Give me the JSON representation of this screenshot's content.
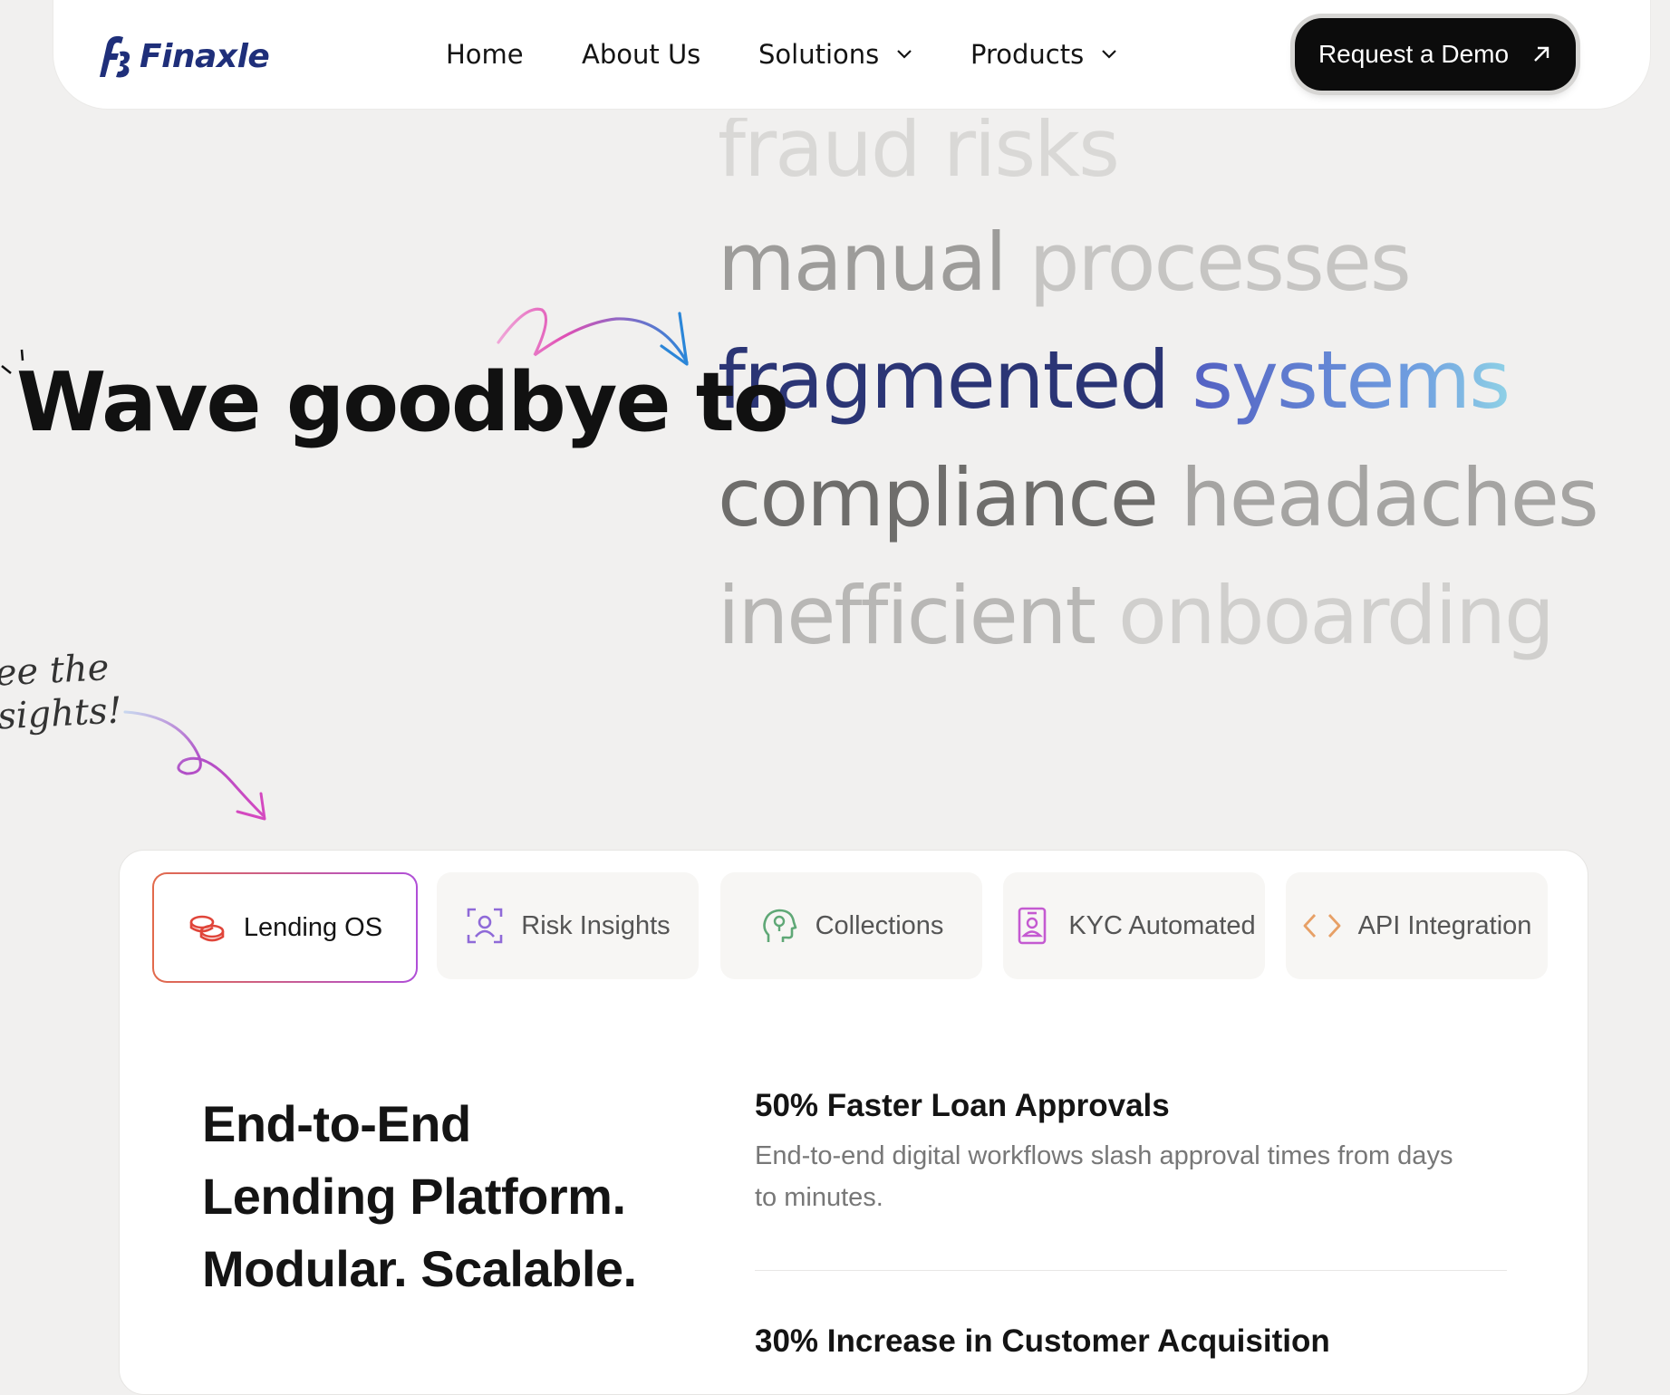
{
  "brand": {
    "name": "Finaxle",
    "primary_color": "#1f2f7a"
  },
  "nav": {
    "items": [
      {
        "label": "Home"
      },
      {
        "label": "About Us"
      },
      {
        "label": "Solutions"
      },
      {
        "label": "Products"
      }
    ],
    "cta_label": "Request a Demo"
  },
  "hero": {
    "heading": "Wave goodbye to",
    "rotating_phrases": [
      {
        "w1": "fraud",
        "w2": "risks"
      },
      {
        "w1": "manual",
        "w2": "processes"
      },
      {
        "w1": "fragmented",
        "w2": "systems"
      },
      {
        "w1": "compliance",
        "w2": "headaches"
      },
      {
        "w1": "inefficient",
        "w2": "onboarding"
      }
    ],
    "script_note_line1": "ee the",
    "script_note_line2": "sights!"
  },
  "tabs": [
    {
      "label": "Lending OS",
      "icon": "coins-icon",
      "active": true,
      "color": "#e0453a"
    },
    {
      "label": "Risk Insights",
      "icon": "scan-user-icon",
      "active": false,
      "color": "#8f6ad8"
    },
    {
      "label": "Collections",
      "icon": "brain-head-icon",
      "active": false,
      "color": "#5fa876"
    },
    {
      "label": "KYC Automated",
      "icon": "id-badge-icon",
      "active": false,
      "color": "#c45ad1"
    },
    {
      "label": "API Integration",
      "icon": "code-brackets-icon",
      "active": false,
      "color": "#e7a066"
    }
  ],
  "feature": {
    "title_line1": "End-to-End",
    "title_line2": "Lending Platform.",
    "title_line3": "Modular. Scalable.",
    "stats": [
      {
        "title": "50% Faster Loan Approvals",
        "desc_line1": "End-to-end digital workflows slash approval times from days",
        "desc_line2": "to minutes."
      },
      {
        "title": "30% Increase in Customer Acquisition"
      }
    ]
  }
}
